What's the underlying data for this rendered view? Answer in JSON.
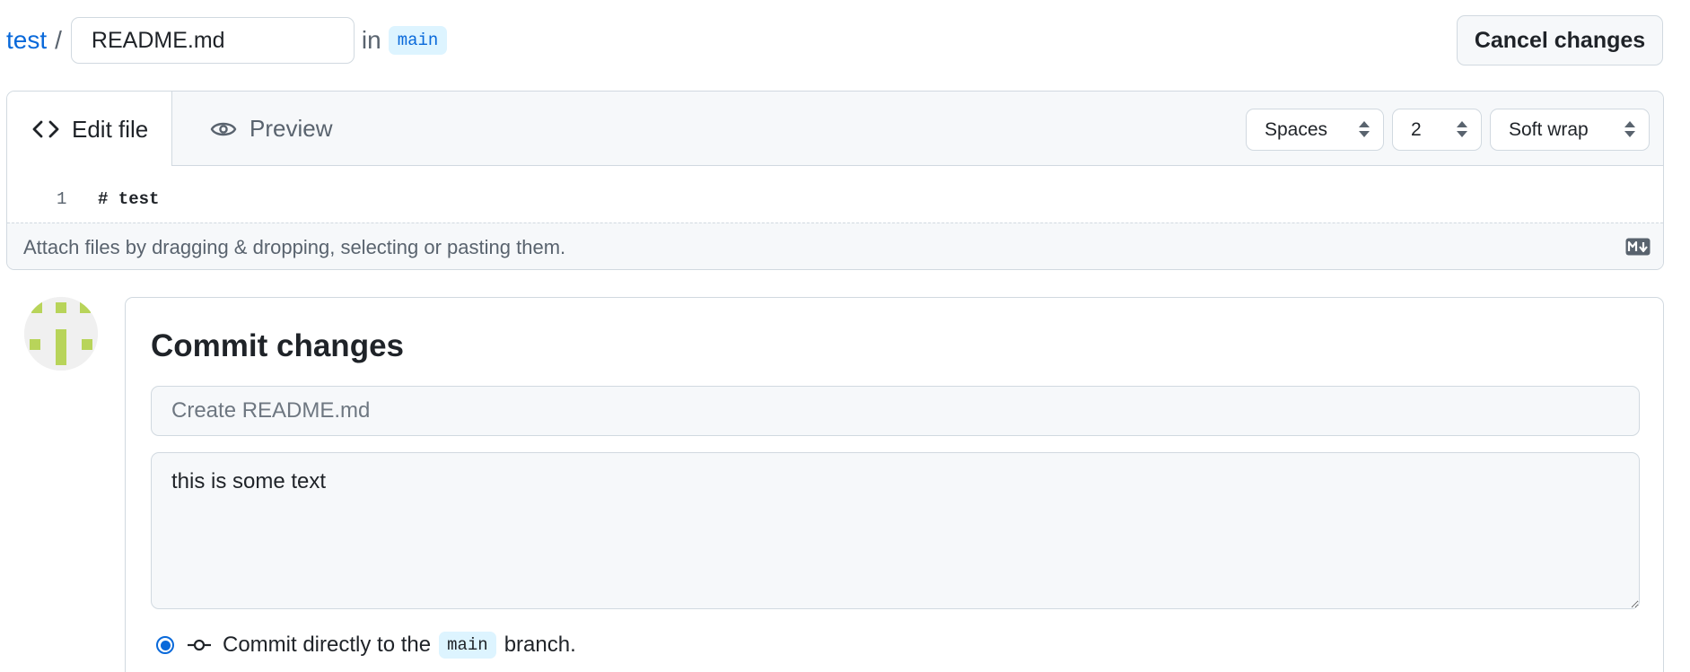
{
  "breadcrumb": {
    "repo": "test",
    "separator": "/",
    "filename_value": "README.md",
    "in_label": "in",
    "branch": "main"
  },
  "header_actions": {
    "cancel_label": "Cancel changes"
  },
  "editor": {
    "tabs": [
      {
        "label": "Edit file",
        "icon": "code-icon",
        "active": true
      },
      {
        "label": "Preview",
        "icon": "eye-icon",
        "active": false
      }
    ],
    "indent_mode": "Spaces",
    "indent_size": "2",
    "wrap_mode": "Soft wrap",
    "lines": [
      {
        "number": "1",
        "content": "# test"
      }
    ],
    "attach_hint": "Attach files by dragging & dropping, selecting or pasting them.",
    "markdown_icon": "markdown-icon"
  },
  "commit": {
    "title": "Commit changes",
    "message_placeholder": "Create README.md",
    "description_value": "this is some text",
    "option_prefix": "Commit directly to the",
    "option_branch": "main",
    "option_suffix": "branch."
  },
  "colors": {
    "accent": "#0969da",
    "border": "#d1d9e0",
    "muted_bg": "#f6f8fa",
    "avatar_green": "#b8d45a"
  }
}
